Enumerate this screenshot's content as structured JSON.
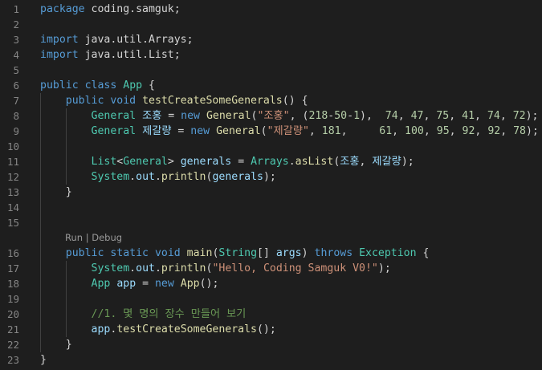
{
  "colors": {
    "background": "#1e1e1e",
    "line_number": "#858585",
    "keyword": "#569cd6",
    "type": "#4ec9b0",
    "function": "#dcdcaa",
    "variable": "#9cdcfe",
    "string": "#ce9178",
    "number": "#b5cea8",
    "comment": "#6a9955",
    "text": "#d4d4d4",
    "codelens": "#999999"
  },
  "codelens": {
    "run": "Run",
    "separator": " | ",
    "debug": "Debug"
  },
  "lines": [
    {
      "number": "1",
      "tokens": [
        {
          "t": "package",
          "c": "keyword"
        },
        {
          "t": " coding.samguk;",
          "c": "text"
        }
      ]
    },
    {
      "number": "2",
      "tokens": []
    },
    {
      "number": "3",
      "tokens": [
        {
          "t": "import",
          "c": "keyword"
        },
        {
          "t": " java.util.Arrays;",
          "c": "text"
        }
      ]
    },
    {
      "number": "4",
      "tokens": [
        {
          "t": "import",
          "c": "keyword"
        },
        {
          "t": " java.util.List;",
          "c": "text"
        }
      ]
    },
    {
      "number": "5",
      "tokens": []
    },
    {
      "number": "6",
      "tokens": [
        {
          "t": "public",
          "c": "keyword"
        },
        {
          "t": " ",
          "c": "text"
        },
        {
          "t": "class",
          "c": "keyword"
        },
        {
          "t": " ",
          "c": "text"
        },
        {
          "t": "App",
          "c": "type"
        },
        {
          "t": " {",
          "c": "text"
        }
      ]
    },
    {
      "number": "7",
      "tokens": [
        {
          "t": "    ",
          "c": "text"
        },
        {
          "t": "public",
          "c": "keyword"
        },
        {
          "t": " ",
          "c": "text"
        },
        {
          "t": "void",
          "c": "keyword"
        },
        {
          "t": " ",
          "c": "text"
        },
        {
          "t": "testCreateSomeGenerals",
          "c": "function"
        },
        {
          "t": "() {",
          "c": "text"
        }
      ]
    },
    {
      "number": "8",
      "tokens": [
        {
          "t": "        ",
          "c": "text"
        },
        {
          "t": "General",
          "c": "type"
        },
        {
          "t": " ",
          "c": "text"
        },
        {
          "t": "조홍",
          "c": "variable"
        },
        {
          "t": " = ",
          "c": "text"
        },
        {
          "t": "new",
          "c": "keyword"
        },
        {
          "t": " ",
          "c": "text"
        },
        {
          "t": "General",
          "c": "function"
        },
        {
          "t": "(",
          "c": "text"
        },
        {
          "t": "\"조홍\"",
          "c": "string"
        },
        {
          "t": ", (",
          "c": "text"
        },
        {
          "t": "218",
          "c": "number"
        },
        {
          "t": "-",
          "c": "text"
        },
        {
          "t": "50",
          "c": "number"
        },
        {
          "t": "-",
          "c": "text"
        },
        {
          "t": "1",
          "c": "number"
        },
        {
          "t": "),  ",
          "c": "text"
        },
        {
          "t": "74",
          "c": "number"
        },
        {
          "t": ", ",
          "c": "text"
        },
        {
          "t": "47",
          "c": "number"
        },
        {
          "t": ", ",
          "c": "text"
        },
        {
          "t": "75",
          "c": "number"
        },
        {
          "t": ", ",
          "c": "text"
        },
        {
          "t": "41",
          "c": "number"
        },
        {
          "t": ", ",
          "c": "text"
        },
        {
          "t": "74",
          "c": "number"
        },
        {
          "t": ", ",
          "c": "text"
        },
        {
          "t": "72",
          "c": "number"
        },
        {
          "t": ");",
          "c": "text"
        }
      ]
    },
    {
      "number": "9",
      "tokens": [
        {
          "t": "        ",
          "c": "text"
        },
        {
          "t": "General",
          "c": "type"
        },
        {
          "t": " ",
          "c": "text"
        },
        {
          "t": "제갈량",
          "c": "variable"
        },
        {
          "t": " = ",
          "c": "text"
        },
        {
          "t": "new",
          "c": "keyword"
        },
        {
          "t": " ",
          "c": "text"
        },
        {
          "t": "General",
          "c": "function"
        },
        {
          "t": "(",
          "c": "text"
        },
        {
          "t": "\"제갈량\"",
          "c": "string"
        },
        {
          "t": ", ",
          "c": "text"
        },
        {
          "t": "181",
          "c": "number"
        },
        {
          "t": ",     ",
          "c": "text"
        },
        {
          "t": "61",
          "c": "number"
        },
        {
          "t": ", ",
          "c": "text"
        },
        {
          "t": "100",
          "c": "number"
        },
        {
          "t": ", ",
          "c": "text"
        },
        {
          "t": "95",
          "c": "number"
        },
        {
          "t": ", ",
          "c": "text"
        },
        {
          "t": "92",
          "c": "number"
        },
        {
          "t": ", ",
          "c": "text"
        },
        {
          "t": "92",
          "c": "number"
        },
        {
          "t": ", ",
          "c": "text"
        },
        {
          "t": "78",
          "c": "number"
        },
        {
          "t": ");",
          "c": "text"
        }
      ]
    },
    {
      "number": "10",
      "tokens": []
    },
    {
      "number": "11",
      "tokens": [
        {
          "t": "        ",
          "c": "text"
        },
        {
          "t": "List",
          "c": "type"
        },
        {
          "t": "<",
          "c": "text"
        },
        {
          "t": "General",
          "c": "type"
        },
        {
          "t": "> ",
          "c": "text"
        },
        {
          "t": "generals",
          "c": "variable"
        },
        {
          "t": " = ",
          "c": "text"
        },
        {
          "t": "Arrays",
          "c": "type"
        },
        {
          "t": ".",
          "c": "text"
        },
        {
          "t": "asList",
          "c": "function"
        },
        {
          "t": "(",
          "c": "text"
        },
        {
          "t": "조홍",
          "c": "variable"
        },
        {
          "t": ", ",
          "c": "text"
        },
        {
          "t": "제갈량",
          "c": "variable"
        },
        {
          "t": ");",
          "c": "text"
        }
      ]
    },
    {
      "number": "12",
      "tokens": [
        {
          "t": "        ",
          "c": "text"
        },
        {
          "t": "System",
          "c": "type"
        },
        {
          "t": ".",
          "c": "text"
        },
        {
          "t": "out",
          "c": "variable"
        },
        {
          "t": ".",
          "c": "text"
        },
        {
          "t": "println",
          "c": "function"
        },
        {
          "t": "(",
          "c": "text"
        },
        {
          "t": "generals",
          "c": "variable"
        },
        {
          "t": ");",
          "c": "text"
        }
      ]
    },
    {
      "number": "13",
      "tokens": [
        {
          "t": "    }",
          "c": "text"
        }
      ]
    },
    {
      "number": "14",
      "tokens": []
    },
    {
      "number": "15",
      "tokens": []
    },
    {
      "number": "16",
      "tokens": [
        {
          "t": "    ",
          "c": "text"
        },
        {
          "t": "public",
          "c": "keyword"
        },
        {
          "t": " ",
          "c": "text"
        },
        {
          "t": "static",
          "c": "keyword"
        },
        {
          "t": " ",
          "c": "text"
        },
        {
          "t": "void",
          "c": "keyword"
        },
        {
          "t": " ",
          "c": "text"
        },
        {
          "t": "main",
          "c": "function"
        },
        {
          "t": "(",
          "c": "text"
        },
        {
          "t": "String",
          "c": "type"
        },
        {
          "t": "[] ",
          "c": "text"
        },
        {
          "t": "args",
          "c": "variable"
        },
        {
          "t": ") ",
          "c": "text"
        },
        {
          "t": "throws",
          "c": "keyword"
        },
        {
          "t": " ",
          "c": "text"
        },
        {
          "t": "Exception",
          "c": "type"
        },
        {
          "t": " {",
          "c": "text"
        }
      ]
    },
    {
      "number": "17",
      "tokens": [
        {
          "t": "        ",
          "c": "text"
        },
        {
          "t": "System",
          "c": "type"
        },
        {
          "t": ".",
          "c": "text"
        },
        {
          "t": "out",
          "c": "variable"
        },
        {
          "t": ".",
          "c": "text"
        },
        {
          "t": "println",
          "c": "function"
        },
        {
          "t": "(",
          "c": "text"
        },
        {
          "t": "\"Hello, Coding Samguk V0!\"",
          "c": "string"
        },
        {
          "t": ");",
          "c": "text"
        }
      ]
    },
    {
      "number": "18",
      "tokens": [
        {
          "t": "        ",
          "c": "text"
        },
        {
          "t": "App",
          "c": "type"
        },
        {
          "t": " ",
          "c": "text"
        },
        {
          "t": "app",
          "c": "variable"
        },
        {
          "t": " = ",
          "c": "text"
        },
        {
          "t": "new",
          "c": "keyword"
        },
        {
          "t": " ",
          "c": "text"
        },
        {
          "t": "App",
          "c": "function"
        },
        {
          "t": "();",
          "c": "text"
        }
      ]
    },
    {
      "number": "19",
      "tokens": []
    },
    {
      "number": "20",
      "tokens": [
        {
          "t": "        ",
          "c": "text"
        },
        {
          "t": "//1. 몇 명의 장수 만들어 보기",
          "c": "comment"
        }
      ]
    },
    {
      "number": "21",
      "tokens": [
        {
          "t": "        ",
          "c": "text"
        },
        {
          "t": "app",
          "c": "variable"
        },
        {
          "t": ".",
          "c": "text"
        },
        {
          "t": "testCreateSomeGenerals",
          "c": "function"
        },
        {
          "t": "();",
          "c": "text"
        }
      ]
    },
    {
      "number": "22",
      "tokens": [
        {
          "t": "    }",
          "c": "text"
        }
      ]
    },
    {
      "number": "23",
      "tokens": [
        {
          "t": "}",
          "c": "text"
        }
      ]
    }
  ]
}
